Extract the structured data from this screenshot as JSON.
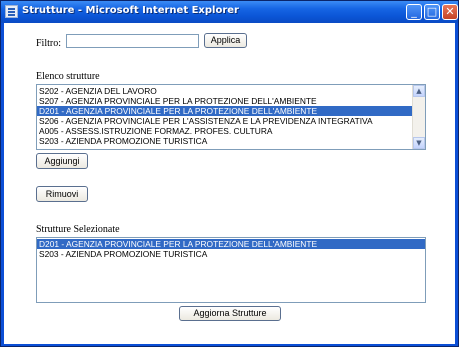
{
  "window": {
    "title": "Strutture - Microsoft Internet Explorer",
    "minimize_glyph": "_",
    "maximize_glyph": "□",
    "close_glyph": "✕"
  },
  "filter": {
    "label": "Filtro:",
    "value": "",
    "button_label": "Applica"
  },
  "structures": {
    "heading": "Elenco  strutture",
    "items": [
      "S202 - AGENZIA DEL LAVORO",
      "S207 - AGENZIA PROVINCIALE PER LA PROTEZIONE DELL'AMBIENTE",
      "D201 - AGENZIA PROVINCIALE PER LA PROTEZIONE DELL'AMBIENTE",
      "S206 - AGENZIA PROVINCIALE PER L'ASSISTENZA E LA PREVIDENZA INTEGRATIVA",
      "A005 - ASSESS.ISTRUZIONE FORMAZ. PROFES. CULTURA",
      "S203 - AZIENDA PROMOZIONE TURISTICA"
    ],
    "selected_index": 2
  },
  "buttons": {
    "add": "Aggiungi",
    "remove": "Rimuovi",
    "update": "Aggiorna Strutture"
  },
  "selected": {
    "heading": "Strutture  Selezionate",
    "items": [
      "D201 - AGENZIA PROVINCIALE PER LA PROTEZIONE DELL'AMBIENTE",
      "S203 - AZIENDA PROMOZIONE TURISTICA"
    ],
    "selected_index": 0
  },
  "scrollbar": {
    "up_glyph": "▲",
    "down_glyph": "▼"
  }
}
